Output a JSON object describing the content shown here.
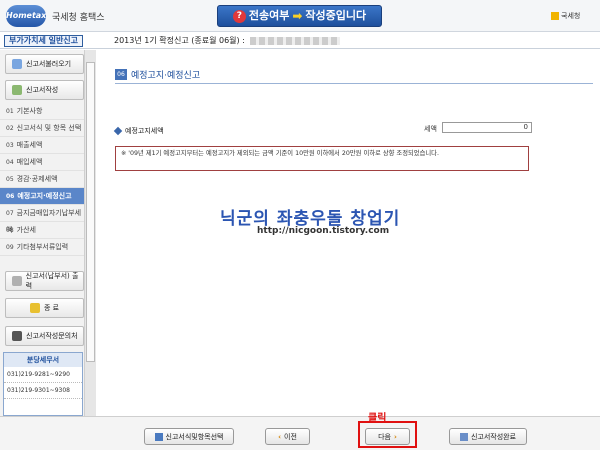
{
  "header": {
    "logo_text": "Hometax",
    "site_title": "국세청 홈택스",
    "status_part1": "전송여부",
    "status_part2": "작성중입니다",
    "nts_label": "국세청"
  },
  "title_row": {
    "breadcrumb": "부가가치세 일반신고",
    "period": "2013년 1기 확정신고 (종료월 06월) : "
  },
  "sidebar": {
    "load_button": "신고서불러오기",
    "write_button": "신고서작성",
    "items": [
      {
        "num": "01",
        "label": "기본사항"
      },
      {
        "num": "02",
        "label": "신고서식 및 항목 선택"
      },
      {
        "num": "03",
        "label": "매출세액"
      },
      {
        "num": "04",
        "label": "매입세액"
      },
      {
        "num": "05",
        "label": "경감·공제세액"
      },
      {
        "num": "06",
        "label": "예정고지·예정신고"
      },
      {
        "num": "07",
        "label": "금지금매입자기납부세액"
      },
      {
        "num": "08",
        "label": "가산세"
      },
      {
        "num": "09",
        "label": "기타첨부서류입력"
      }
    ],
    "print_button": "신고서(납부서) 출력",
    "end_button": "종 료",
    "inquiry_button": "신고서작성문의처",
    "office": {
      "title": "분당세무서",
      "phone1": "031)219-9281~9290",
      "phone2": "031)219-9301~9308"
    }
  },
  "main": {
    "section_num": "06",
    "section_title": "예정고지·예정신고",
    "item_label": "예정고지세액",
    "tax_label": "세액",
    "tax_value": "0",
    "notice": "※ '09년 제1기 예정고지부터는 예정고지가 제외되는 금액 기준이 10만원 이하에서 20만원 이하로 상향 조정되었습니다.",
    "watermark_title": "닉군의 좌충우돌 창업기",
    "watermark_url": "http://nicgoon.tistory.com"
  },
  "footer": {
    "select_button": "신고서식및항목선택",
    "prev_button": "이전",
    "next_button": "다음",
    "complete_button": "신고서작성완료",
    "click_label": "클릭"
  }
}
